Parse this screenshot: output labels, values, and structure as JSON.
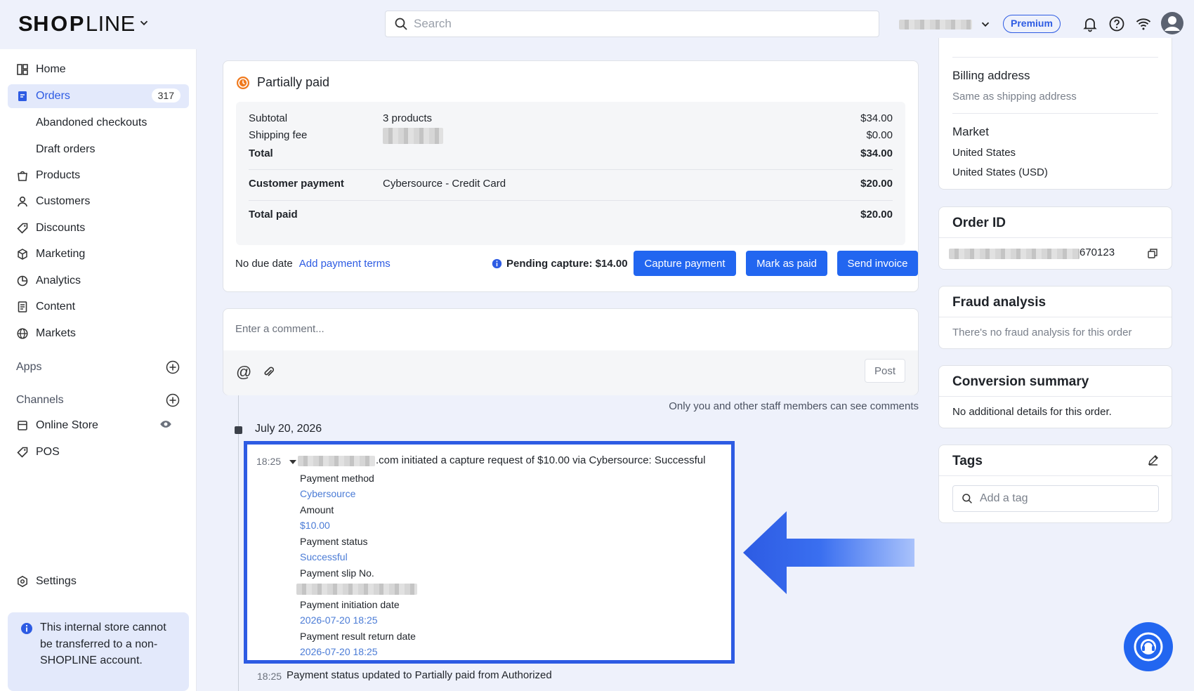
{
  "header": {
    "logo_bold": "SH",
    "logo_o": "O",
    "logo_p": "P",
    "logo_light": "LINE",
    "search_placeholder": "Search",
    "premium_label": "Premium"
  },
  "sidebar": {
    "items": [
      {
        "label": "Home"
      },
      {
        "label": "Orders",
        "badge": "317"
      },
      {
        "label": "Abandoned checkouts"
      },
      {
        "label": "Draft orders"
      },
      {
        "label": "Products"
      },
      {
        "label": "Customers"
      },
      {
        "label": "Discounts"
      },
      {
        "label": "Marketing"
      },
      {
        "label": "Analytics"
      },
      {
        "label": "Content"
      },
      {
        "label": "Markets"
      }
    ],
    "apps_label": "Apps",
    "channels_label": "Channels",
    "online_store_label": "Online Store",
    "pos_label": "POS",
    "settings_label": "Settings",
    "info_text": "This internal store cannot be transferred to a non-SHOPLINE account."
  },
  "payment": {
    "title": "Partially paid",
    "subtotal_label": "Subtotal",
    "subtotal_detail": "3 products",
    "subtotal_value": "$34.00",
    "shipping_label": "Shipping fee",
    "shipping_value": "$0.00",
    "total_label": "Total",
    "total_value": "$34.00",
    "customer_payment_label": "Customer payment",
    "customer_payment_method": "Cybersource - Credit Card",
    "customer_payment_value": "$20.00",
    "total_paid_label": "Total paid",
    "total_paid_value": "$20.00",
    "no_due_date": "No due date",
    "add_terms_link": "Add payment terms",
    "pending_capture": "Pending capture: $14.00",
    "capture_button": "Capture payment",
    "mark_paid_button": "Mark as paid",
    "send_invoice_button": "Send invoice"
  },
  "comment": {
    "placeholder": "Enter a comment...",
    "at_symbol": "@",
    "post_button": "Post",
    "staff_note": "Only you and other staff members can see comments"
  },
  "timeline": {
    "date": "July 20, 2026",
    "event1": {
      "time": "18:25",
      "text": ".com initiated a capture request of $10.00 via Cybersource: Successful",
      "fields": [
        {
          "label": "Payment method",
          "value": "Cybersource"
        },
        {
          "label": "Amount",
          "value": "$10.00"
        },
        {
          "label": "Payment status",
          "value": "Successful"
        },
        {
          "label": "Payment slip No.",
          "value": ""
        },
        {
          "label": "Payment initiation date",
          "value": "2026-07-20 18:25"
        },
        {
          "label": "Payment result return date",
          "value": "2026-07-20 18:25"
        }
      ]
    },
    "event2": {
      "time": "18:25",
      "text": "Payment status updated to Partially paid from Authorized"
    }
  },
  "right": {
    "billing_title": "Billing address",
    "billing_value": "Same as shipping address",
    "market_title": "Market",
    "market_line1": "United States",
    "market_line2": "United States (USD)",
    "order_id_title": "Order ID",
    "order_id_suffix": "670123",
    "fraud_title": "Fraud analysis",
    "fraud_text": "There's no fraud analysis for this order",
    "conversion_title": "Conversion summary",
    "conversion_text": "No additional details for this order.",
    "tags_title": "Tags",
    "tags_placeholder": "Add a tag"
  },
  "colors": {
    "accent": "#2266f0",
    "highlight_border": "#2d5be3",
    "status_orange": "#f07a1e"
  }
}
